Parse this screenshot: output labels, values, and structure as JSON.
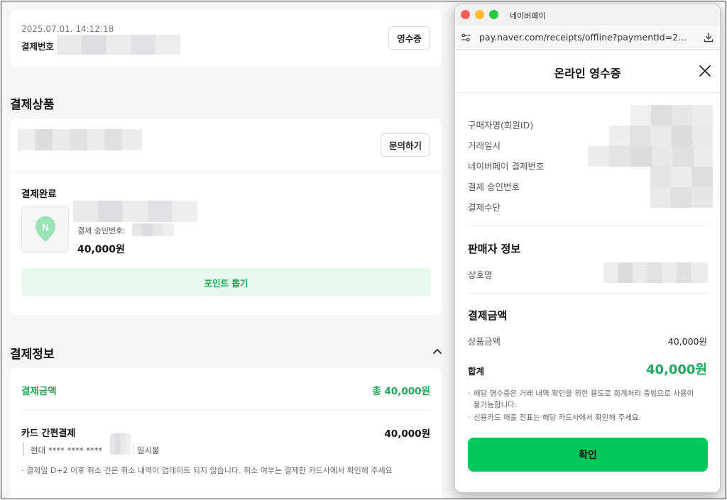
{
  "order": {
    "datetime": "2025.07.01. 14:12:18",
    "payment_no_label": "결제번호",
    "receipt_button": "영수증"
  },
  "products": {
    "section_title": "결제상품",
    "inquiry_button": "문의하기",
    "status": "결제완료",
    "approval_label": "결제 승인번호:",
    "price": "40,000원",
    "point_button": "포인트 뽑기",
    "thumbnail_icon": "naver-pay-n-icon"
  },
  "payment_info": {
    "section_title": "결제정보",
    "collapse_icon": "chevron-up-icon",
    "amount_label": "결제금액",
    "amount_value": "총 40,000원",
    "method_label": "카드 간편결제",
    "method_value": "40,000원",
    "card_text": "현대 **** **** ****",
    "installment": "일시불",
    "notice": "· 결제일 D+2 이후 취소 건은 취소 내역이 업데이트 되지 않습니다. 취소 여부는 결제한 카드사에서 확인해 주세요"
  },
  "popup": {
    "window_title": "네이버페이",
    "url": "pay.naver.com/receipts/offline?paymentId=2...",
    "header": "온라인 영수증",
    "buyer_rows": [
      "구매자명(회원ID)",
      "거래일시",
      "네이버페이 결제번호",
      "결제 승인번호",
      "결제수단"
    ],
    "seller_title": "판매자 정보",
    "seller_label": "상호명",
    "amount_title": "결제금액",
    "product_amount_label": "상품금액",
    "product_amount_value": "40,000원",
    "total_label": "합계",
    "total_value": "40,000원",
    "notice_1": "해당 영수증은 거래 내역 확인을 위한 용도로 회계처리 증빙으로 사용이 불가능합니다.",
    "notice_2": "신용카드 매출 전표는 해당 카드사에서 확인해 주세요.",
    "confirm_button": "확인"
  },
  "colors": {
    "naver_green": "#03c75a",
    "green_text": "#1fa85a",
    "point_bg": "#e6f9ec"
  }
}
